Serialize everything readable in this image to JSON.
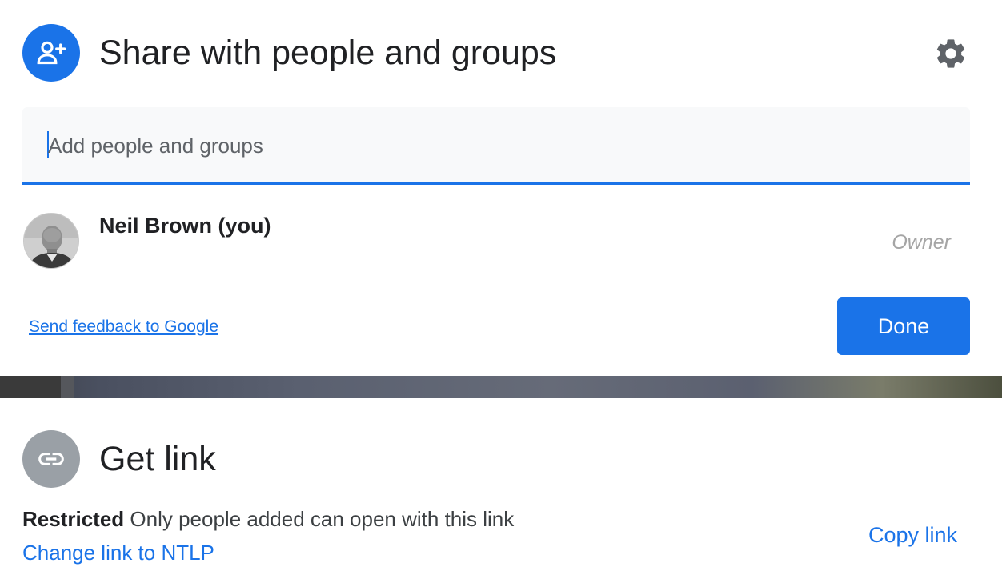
{
  "share": {
    "title": "Share with people and groups",
    "header_icon": "person-add-icon",
    "settings_icon": "gear-icon",
    "add_placeholder": "Add people and groups",
    "people": [
      {
        "name": "Neil Brown (you)",
        "role": "Owner"
      }
    ],
    "feedback_link": "Send feedback to Google",
    "done_label": "Done"
  },
  "get_link": {
    "title": "Get link",
    "icon": "link-icon",
    "restriction_label": "Restricted",
    "restriction_desc": "Only people added can open with this link",
    "change_link": "Change link to NTLP",
    "copy_link": "Copy link"
  },
  "colors": {
    "accent": "#1a73e8",
    "link_icon_bg": "#9aa0a6",
    "role_text": "#a5a5a5"
  }
}
